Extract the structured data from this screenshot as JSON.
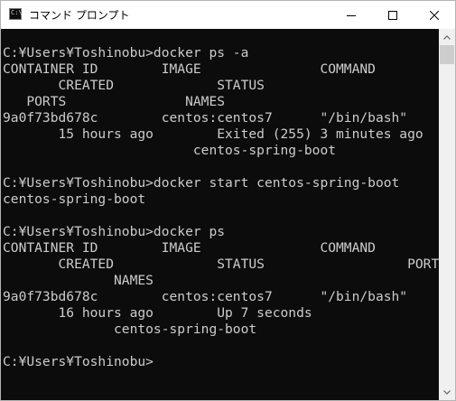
{
  "window": {
    "title": "コマンド プロンプト",
    "icon": "console-app-icon",
    "icon_glyph": "C:\\",
    "controls": [
      "minimize-icon",
      "maximize-icon",
      "close-icon"
    ]
  },
  "console": {
    "lines": [
      "",
      "C:¥Users¥Toshinobu>docker ps -a",
      "CONTAINER ID        IMAGE               COMMAND",
      "       CREATED             STATUS",
      "   PORTS               NAMES",
      "9a0f73bd678c        centos:centos7      \"/bin/bash\"",
      "       15 hours ago        Exited (255) 3 minutes ago",
      "                        centos-spring-boot",
      "",
      "C:¥Users¥Toshinobu>docker start centos-spring-boot",
      "centos-spring-boot",
      "",
      "C:¥Users¥Toshinobu>docker ps",
      "CONTAINER ID        IMAGE               COMMAND",
      "       CREATED             STATUS                  PORTS",
      "              NAMES",
      "9a0f73bd678c        centos:centos7      \"/bin/bash\"",
      "       16 hours ago        Up 7 seconds",
      "              centos-spring-boot",
      "",
      "C:¥Users¥Toshinobu>"
    ]
  },
  "colors": {
    "console_background": "#0c0c0c",
    "console_text": "#cccccc",
    "titlebar_background": "#ffffff",
    "scrollbar_track": "#f0f0f0",
    "scrollbar_thumb": "#cdcdcd"
  }
}
